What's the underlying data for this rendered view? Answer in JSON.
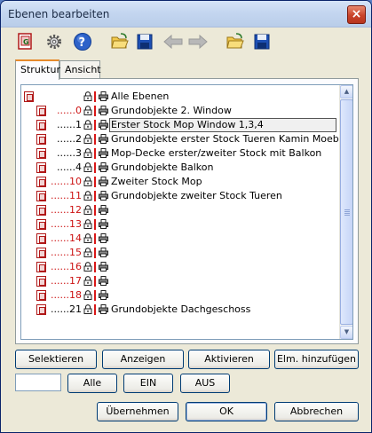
{
  "window": {
    "title": "Ebenen bearbeiten",
    "close_glyph": "×"
  },
  "toolbar": {
    "buttons": [
      "layer-settings-icon",
      "gear-icon",
      "help-icon",
      "open-folder-icon",
      "save-icon",
      "arrow-left-icon",
      "arrow-right-icon",
      "open-folder-icon",
      "save-icon"
    ]
  },
  "tabs": [
    {
      "label": "Struktur",
      "active": true
    },
    {
      "label": "Ansicht",
      "active": false
    }
  ],
  "layers": [
    {
      "num": "",
      "name": "Alle Ebenen",
      "red": false,
      "root": true
    },
    {
      "num": "......0",
      "name": "Grundobjekte 2. Window",
      "red": true
    },
    {
      "num": "......1",
      "name": "Erster Stock Mop Window 1,3,4",
      "red": false,
      "selected": true
    },
    {
      "num": "......2",
      "name": "Grundobjekte erster Stock Tueren Kamin Moebel",
      "red": false
    },
    {
      "num": "......3",
      "name": "Mop-Decke erster/zweiter Stock mit Balkon",
      "red": false
    },
    {
      "num": "......4",
      "name": "Grundobjekte Balkon",
      "red": false
    },
    {
      "num": "......10",
      "name": "Zweiter Stock Mop",
      "red": true
    },
    {
      "num": "......11",
      "name": "Grundobjekte zweiter Stock Tueren",
      "red": true
    },
    {
      "num": "......12",
      "name": "",
      "red": true
    },
    {
      "num": "......13",
      "name": "",
      "red": true
    },
    {
      "num": "......14",
      "name": "",
      "red": true
    },
    {
      "num": "......15",
      "name": "",
      "red": true
    },
    {
      "num": "......16",
      "name": "",
      "red": true
    },
    {
      "num": "......17",
      "name": "",
      "red": true
    },
    {
      "num": "......18",
      "name": "",
      "red": true
    },
    {
      "num": "......21",
      "name": "Grundobjekte Dachgeschoss",
      "red": false
    }
  ],
  "scrollbar": {
    "up": "▲",
    "down": "▼"
  },
  "actions": {
    "select": "Selektieren",
    "show": "Anzeigen",
    "activate": "Aktivieren",
    "add_element": "Elm. hinzufügen"
  },
  "filter": {
    "value": "",
    "all": "Alle",
    "on": "EIN",
    "off": "AUS"
  },
  "footer": {
    "apply": "Übernehmen",
    "ok": "OK",
    "cancel": "Abbrechen"
  },
  "colors": {
    "red": "#cc1111",
    "accent": "#e68b2c",
    "border": "#003c74"
  }
}
